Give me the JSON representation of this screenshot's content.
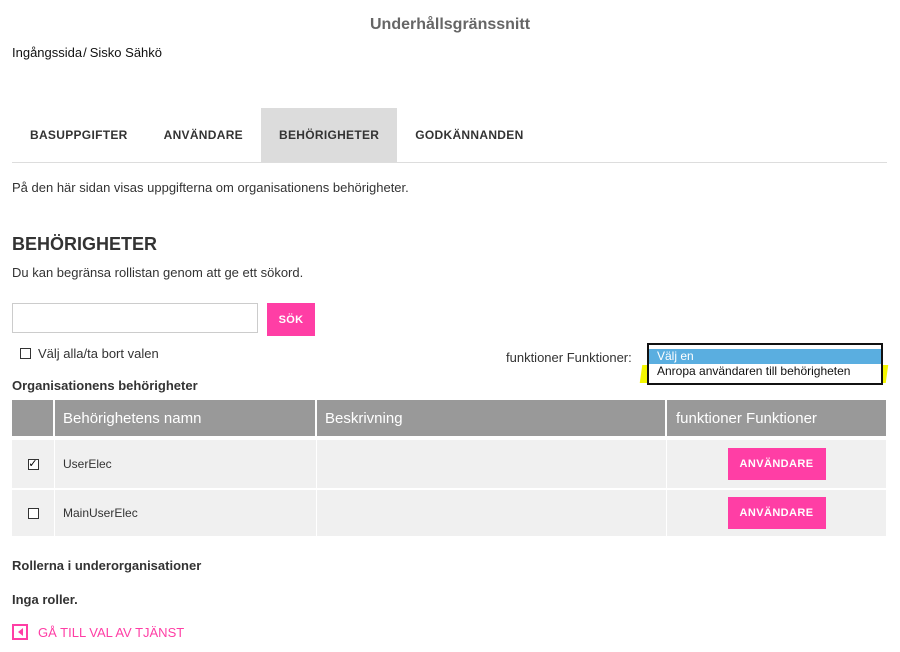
{
  "header": {
    "title": "Underhållsgränssnitt"
  },
  "breadcrumb": {
    "home": "Ingångssida",
    "separator": "/",
    "current": "Sisko Sähkö"
  },
  "tabs": [
    {
      "label": "BASUPPGIFTER",
      "active": false
    },
    {
      "label": "ANVÄNDARE",
      "active": false
    },
    {
      "label": "BEHÖRIGHETER",
      "active": true
    },
    {
      "label": "GODKÄNNANDEN",
      "active": false
    }
  ],
  "intro": "På den här sidan visas uppgifterna om organisationens behörigheter.",
  "section": {
    "heading": "BEHÖRIGHETER",
    "hint": "Du kan begränsa rollistan genom att ge ett sökord."
  },
  "search": {
    "value": "",
    "placeholder": "",
    "button_label": "SÖK"
  },
  "select_all": {
    "label": "Välj alla/ta bort valen",
    "checked": false
  },
  "functions": {
    "label": "funktioner Funktioner:",
    "selected": "Välj en",
    "highlighted_option": "Anropa användaren till behörigheten"
  },
  "table": {
    "heading": "Organisationens behörigheter",
    "columns": [
      "",
      "Behörighetens namn",
      "Beskrivning",
      "funktioner Funktioner"
    ],
    "rows": [
      {
        "checked": true,
        "check_glyph": "✓",
        "name": "UserElec",
        "description": "",
        "action": "ANVÄNDARE"
      },
      {
        "checked": false,
        "check_glyph": "",
        "name": "MainUserElec",
        "description": "",
        "action": "ANVÄNDARE"
      }
    ]
  },
  "sub_orgs": {
    "heading": "Rollerna i underorganisationer",
    "empty_text": "Inga roller."
  },
  "back_link": {
    "label": "GÅ TILL VAL AV TJÄNST"
  },
  "colors": {
    "accent": "#ff3ea5",
    "header_bg": "#999999",
    "active_tab_bg": "#dcdcdc",
    "highlight": "#f4f700",
    "selected_option": "#5aaee0"
  }
}
